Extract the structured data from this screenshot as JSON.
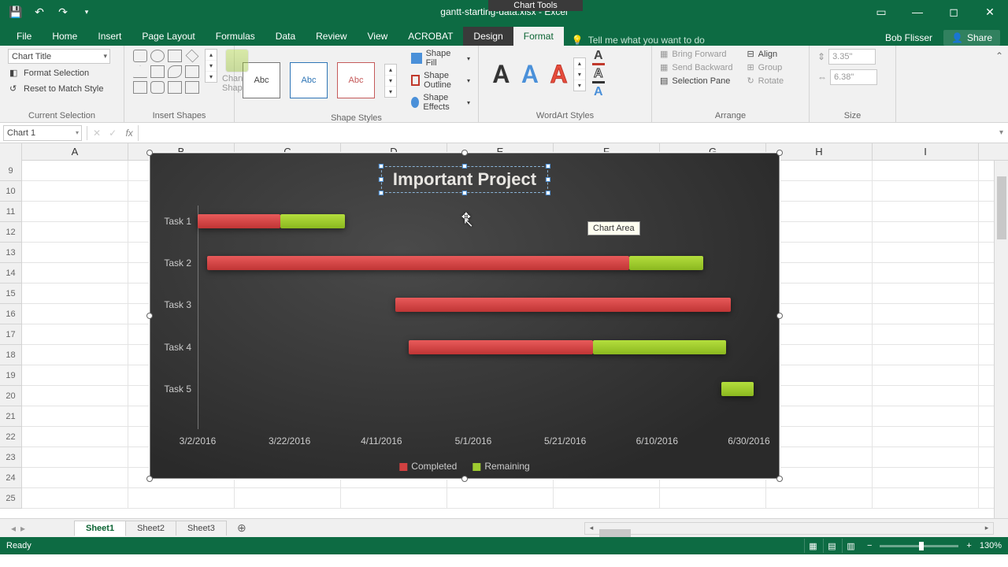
{
  "titlebar": {
    "doc_name": "gantt-starting-data.xlsx - Excel",
    "contextual_label": "Chart Tools"
  },
  "tabs": {
    "file": "File",
    "home": "Home",
    "insert": "Insert",
    "pagelayout": "Page Layout",
    "formulas": "Formulas",
    "data": "Data",
    "review": "Review",
    "view": "View",
    "acrobat": "ACROBAT",
    "design": "Design",
    "format": "Format",
    "tellme": "Tell me what you want to do",
    "user": "Bob Flisser",
    "share": "Share"
  },
  "ribbon": {
    "currentSelection": {
      "label": "Current Selection",
      "combo": "Chart Title",
      "formatSelection": "Format Selection",
      "resetToMatch": "Reset to Match Style"
    },
    "insertShapes": {
      "label": "Insert Shapes",
      "changeShape": "Change Shape"
    },
    "shapeStyles": {
      "label": "Shape Styles",
      "swatch": "Abc",
      "shapeFill": "Shape Fill",
      "shapeOutline": "Shape Outline",
      "shapeEffects": "Shape Effects"
    },
    "wordartStyles": {
      "label": "WordArt Styles",
      "letter": "A"
    },
    "arrange": {
      "label": "Arrange",
      "bringForward": "Bring Forward",
      "sendBackward": "Send Backward",
      "selectionPane": "Selection Pane",
      "align": "Align",
      "group": "Group",
      "rotate": "Rotate"
    },
    "size": {
      "label": "Size",
      "height": "3.35\"",
      "width": "6.38\""
    }
  },
  "namebox": "Chart 1",
  "columns": [
    "A",
    "B",
    "C",
    "D",
    "E",
    "F",
    "G",
    "H",
    "I"
  ],
  "rows": [
    "9",
    "10",
    "11",
    "12",
    "13",
    "14",
    "15",
    "16",
    "17",
    "18",
    "19",
    "20",
    "21",
    "22",
    "23",
    "24",
    "25"
  ],
  "chart": {
    "title": "Important Project",
    "tooltip": "Chart Area",
    "legend": {
      "completed": "Completed",
      "remaining": "Remaining"
    }
  },
  "chart_data": {
    "type": "bar",
    "orientation": "horizontal-stacked",
    "title": "Important Project",
    "ylabel": "",
    "xlabel": "",
    "categories": [
      "Task 1",
      "Task 2",
      "Task 3",
      "Task 4",
      "Task 5"
    ],
    "x_ticks": [
      "3/2/2016",
      "3/22/2016",
      "4/11/2016",
      "5/1/2016",
      "5/21/2016",
      "6/10/2016",
      "6/30/2016"
    ],
    "x_range": [
      "3/2/2016",
      "6/30/2016"
    ],
    "series": [
      {
        "name": "Start (offset)",
        "role": "invisible-offset",
        "values": [
          "3/2/2016",
          "3/4/2016",
          "4/14/2016",
          "4/17/2016",
          "6/24/2016"
        ]
      },
      {
        "name": "Completed",
        "color": "#d24141",
        "values_days": [
          18,
          92,
          73,
          40,
          0
        ]
      },
      {
        "name": "Remaining",
        "color": "#9ecb30",
        "values_days": [
          14,
          16,
          0,
          29,
          7
        ]
      }
    ],
    "legend": [
      "Completed",
      "Remaining"
    ]
  },
  "sheets": {
    "s1": "Sheet1",
    "s2": "Sheet2",
    "s3": "Sheet3"
  },
  "status": {
    "ready": "Ready",
    "zoom": "130%"
  }
}
